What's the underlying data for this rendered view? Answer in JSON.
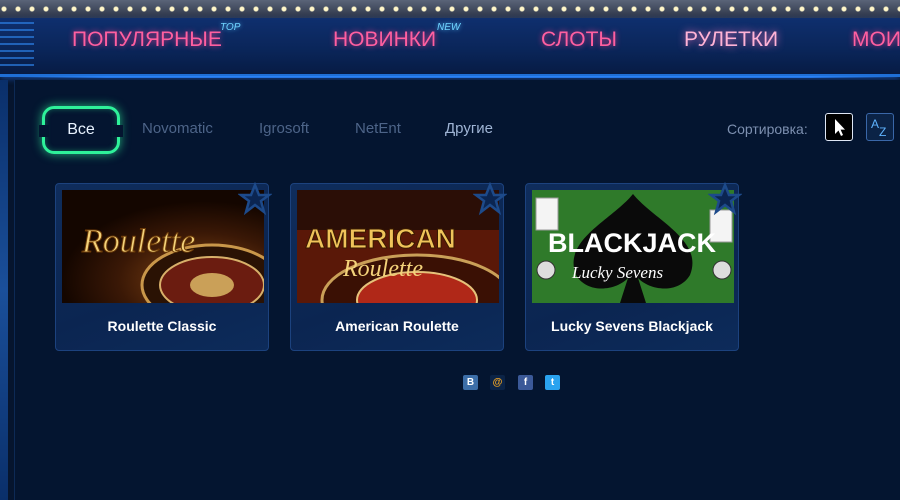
{
  "nav": {
    "items": [
      {
        "label": "ПОПУЛЯРНЫЕ",
        "badge": "TOP"
      },
      {
        "label": "НОВИНКИ",
        "badge": "NEW"
      },
      {
        "label": "СЛОТЫ"
      },
      {
        "label": "РУЛЕТКИ",
        "active": true
      },
      {
        "label": "МОИ"
      }
    ]
  },
  "filters": {
    "all_label": "Все",
    "providers": [
      "Novomatic",
      "Igrosoft",
      "NetEnt"
    ],
    "other_label": "Другие"
  },
  "sort": {
    "label": "Сортировка:",
    "options": [
      "pointer-icon",
      "az-sort-icon"
    ],
    "az_glyph_a": "A",
    "az_glyph_z": "Z"
  },
  "games": [
    {
      "title": "Roulette Classic",
      "thumb_text": "Roulette"
    },
    {
      "title": "American Roulette",
      "thumb_text_1": "AMERICAN",
      "thumb_text_2": "Roulette"
    },
    {
      "title": "Lucky Sevens Blackjack",
      "thumb_text_1": "BLACKJACK",
      "thumb_text_2": "Lucky Sevens"
    }
  ],
  "social": {
    "vk": "B",
    "mail": "@",
    "facebook": "f",
    "twitter": "t"
  },
  "colors": {
    "nav_text": "#ff5fa0",
    "active_filter_border": "#2ef19a",
    "badge": "#6fd3ff",
    "background": "#06152e"
  }
}
